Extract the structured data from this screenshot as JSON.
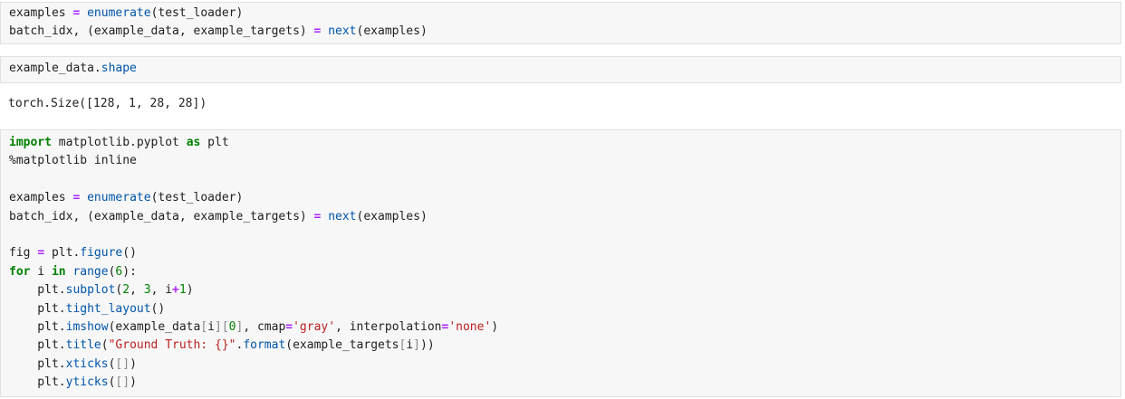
{
  "cells": [
    {
      "id": "cell1",
      "lines": [
        [
          {
            "t": "examples ",
            "c": "plain"
          },
          {
            "t": "=",
            "c": "op"
          },
          {
            "t": " ",
            "c": "plain"
          },
          {
            "t": "enumerate",
            "c": "fn"
          },
          {
            "t": "(test_loader)",
            "c": "plain"
          }
        ],
        [
          {
            "t": "batch_idx, (example_data, example_targets) ",
            "c": "plain"
          },
          {
            "t": "=",
            "c": "op"
          },
          {
            "t": " ",
            "c": "plain"
          },
          {
            "t": "next",
            "c": "fn"
          },
          {
            "t": "(examples)",
            "c": "plain"
          }
        ]
      ]
    },
    {
      "id": "cell2",
      "lines": [
        [
          {
            "t": "example_data.",
            "c": "plain"
          },
          {
            "t": "shape",
            "c": "fn"
          }
        ]
      ],
      "output": "torch.Size([128, 1, 28, 28])"
    },
    {
      "id": "cell3",
      "lines": [
        [
          {
            "t": "import",
            "c": "kw"
          },
          {
            "t": " matplotlib.pyplot ",
            "c": "plain"
          },
          {
            "t": "as",
            "c": "kw"
          },
          {
            "t": " plt",
            "c": "plain"
          }
        ],
        [
          {
            "t": "%matplotlib inline",
            "c": "magic"
          }
        ],
        [],
        [
          {
            "t": "examples ",
            "c": "plain"
          },
          {
            "t": "=",
            "c": "op"
          },
          {
            "t": " ",
            "c": "plain"
          },
          {
            "t": "enumerate",
            "c": "fn"
          },
          {
            "t": "(test_loader)",
            "c": "plain"
          }
        ],
        [
          {
            "t": "batch_idx, (example_data, example_targets) ",
            "c": "plain"
          },
          {
            "t": "=",
            "c": "op"
          },
          {
            "t": " ",
            "c": "plain"
          },
          {
            "t": "next",
            "c": "fn"
          },
          {
            "t": "(examples)",
            "c": "plain"
          }
        ],
        [],
        [
          {
            "t": "fig ",
            "c": "plain"
          },
          {
            "t": "=",
            "c": "op"
          },
          {
            "t": " plt.",
            "c": "plain"
          },
          {
            "t": "figure",
            "c": "fn"
          },
          {
            "t": "()",
            "c": "plain"
          }
        ],
        [
          {
            "t": "for",
            "c": "kw"
          },
          {
            "t": " i ",
            "c": "plain"
          },
          {
            "t": "in",
            "c": "kw"
          },
          {
            "t": " ",
            "c": "plain"
          },
          {
            "t": "range",
            "c": "fn"
          },
          {
            "t": "(",
            "c": "plain"
          },
          {
            "t": "6",
            "c": "num"
          },
          {
            "t": "):",
            "c": "plain"
          }
        ],
        [
          {
            "t": "    plt.",
            "c": "plain"
          },
          {
            "t": "subplot",
            "c": "fn"
          },
          {
            "t": "(",
            "c": "plain"
          },
          {
            "t": "2",
            "c": "num"
          },
          {
            "t": ", ",
            "c": "plain"
          },
          {
            "t": "3",
            "c": "num"
          },
          {
            "t": ", i",
            "c": "plain"
          },
          {
            "t": "+",
            "c": "op"
          },
          {
            "t": "1",
            "c": "num"
          },
          {
            "t": ")",
            "c": "plain"
          }
        ],
        [
          {
            "t": "    plt.",
            "c": "plain"
          },
          {
            "t": "tight_layout",
            "c": "fn"
          },
          {
            "t": "()",
            "c": "plain"
          }
        ],
        [
          {
            "t": "    plt.",
            "c": "plain"
          },
          {
            "t": "imshow",
            "c": "fn"
          },
          {
            "t": "(example_data",
            "c": "plain"
          },
          {
            "t": "[",
            "c": "br"
          },
          {
            "t": "i",
            "c": "plain"
          },
          {
            "t": "][",
            "c": "br"
          },
          {
            "t": "0",
            "c": "num"
          },
          {
            "t": "]",
            "c": "br"
          },
          {
            "t": ", cmap",
            "c": "plain"
          },
          {
            "t": "=",
            "c": "op"
          },
          {
            "t": "'gray'",
            "c": "str"
          },
          {
            "t": ", interpolation",
            "c": "plain"
          },
          {
            "t": "=",
            "c": "op"
          },
          {
            "t": "'none'",
            "c": "str"
          },
          {
            "t": ")",
            "c": "plain"
          }
        ],
        [
          {
            "t": "    plt.",
            "c": "plain"
          },
          {
            "t": "title",
            "c": "fn"
          },
          {
            "t": "(",
            "c": "plain"
          },
          {
            "t": "\"Ground Truth: {}\"",
            "c": "str"
          },
          {
            "t": ".",
            "c": "plain"
          },
          {
            "t": "format",
            "c": "fn"
          },
          {
            "t": "(example_targets",
            "c": "plain"
          },
          {
            "t": "[",
            "c": "br"
          },
          {
            "t": "i",
            "c": "plain"
          },
          {
            "t": "]",
            "c": "br"
          },
          {
            "t": "))",
            "c": "plain"
          }
        ],
        [
          {
            "t": "    plt.",
            "c": "plain"
          },
          {
            "t": "xticks",
            "c": "fn"
          },
          {
            "t": "(",
            "c": "plain"
          },
          {
            "t": "[]",
            "c": "br"
          },
          {
            "t": ")",
            "c": "plain"
          }
        ],
        [
          {
            "t": "    plt.",
            "c": "plain"
          },
          {
            "t": "yticks",
            "c": "fn"
          },
          {
            "t": "(",
            "c": "plain"
          },
          {
            "t": "[]",
            "c": "br"
          },
          {
            "t": ")",
            "c": "plain"
          }
        ]
      ]
    }
  ]
}
